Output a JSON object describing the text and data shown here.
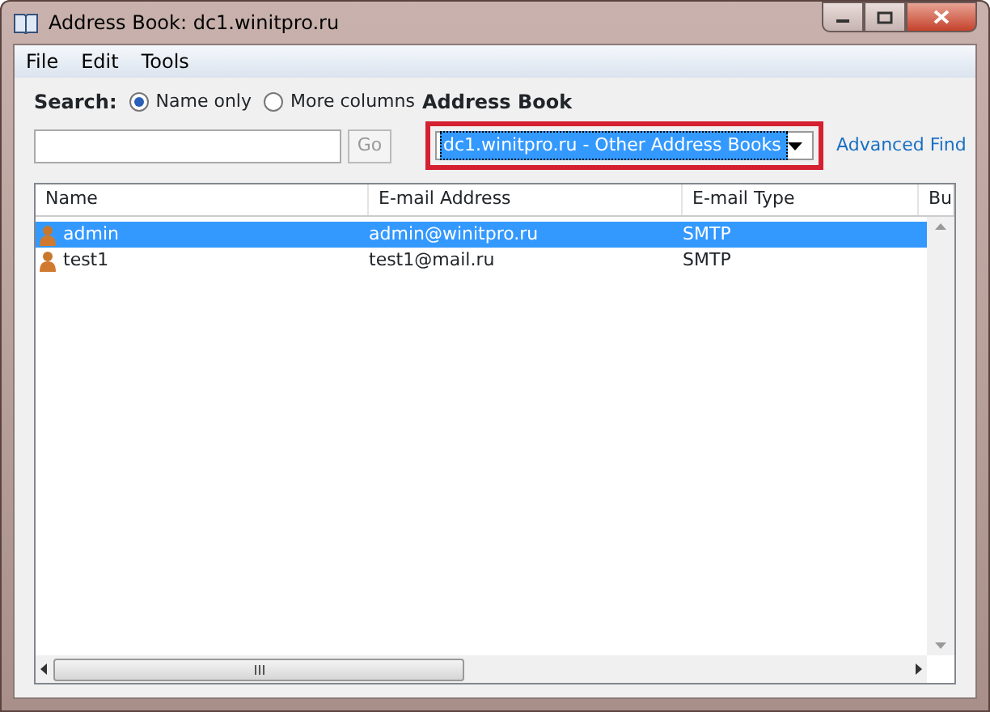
{
  "window": {
    "title": "Address Book: dc1.winitpro.ru"
  },
  "menu": [
    {
      "label": "File"
    },
    {
      "label": "Edit"
    },
    {
      "label": "Tools"
    }
  ],
  "search": {
    "label": "Search:",
    "options": [
      {
        "label": "Name only",
        "selected": true
      },
      {
        "label": "More columns",
        "selected": false
      }
    ],
    "go": "Go",
    "disabled": true
  },
  "address_book": {
    "label": "Address Book",
    "value": "dc1.winitpro.ru - Other Address Books",
    "highlighted": true
  },
  "advanced_find": "Advanced Find",
  "table": {
    "columns": [
      "Name",
      "E-mail Address",
      "E-mail Type",
      "Bu"
    ],
    "rows": [
      {
        "cells": [
          "admin",
          "admin@winitpro.ru",
          "SMTP"
        ],
        "selected": true
      },
      {
        "cells": [
          "test1",
          "test1@mail.ru",
          "SMTP"
        ],
        "selected": false
      }
    ]
  }
}
